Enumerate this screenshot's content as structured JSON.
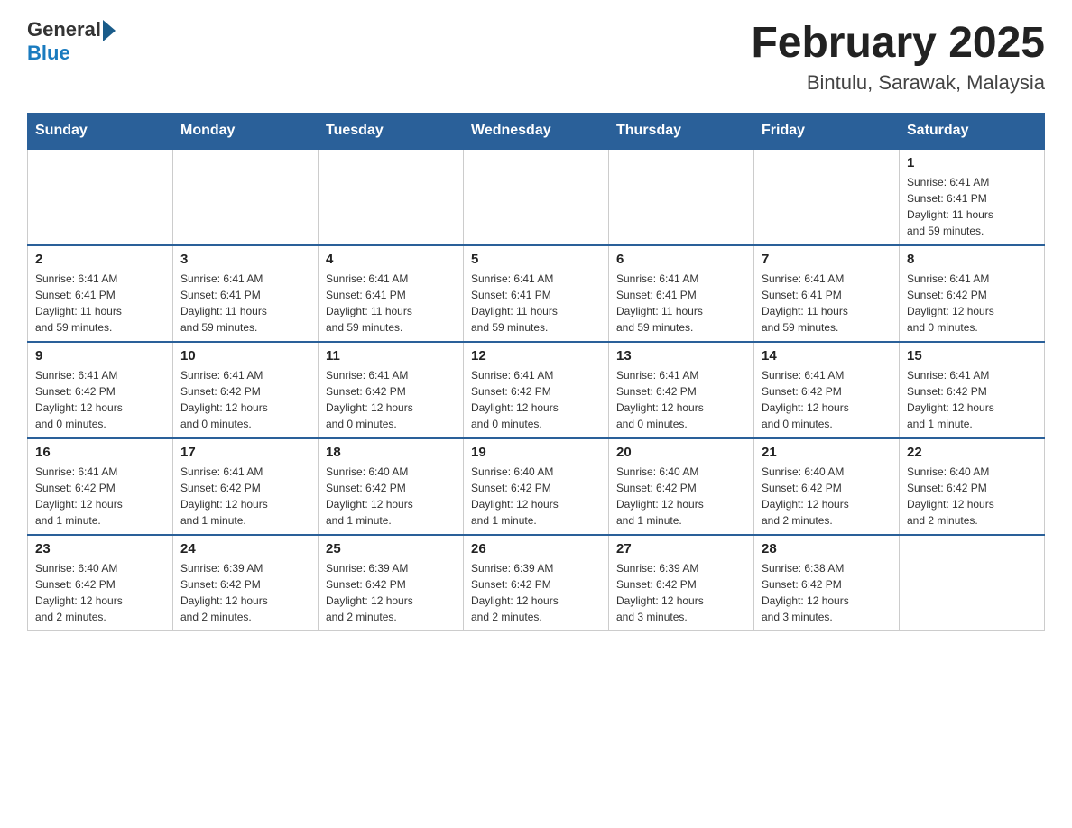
{
  "header": {
    "logo_general": "General",
    "logo_blue": "Blue",
    "title": "February 2025",
    "subtitle": "Bintulu, Sarawak, Malaysia"
  },
  "weekdays": [
    "Sunday",
    "Monday",
    "Tuesday",
    "Wednesday",
    "Thursday",
    "Friday",
    "Saturday"
  ],
  "weeks": [
    [
      {
        "day": "",
        "info": ""
      },
      {
        "day": "",
        "info": ""
      },
      {
        "day": "",
        "info": ""
      },
      {
        "day": "",
        "info": ""
      },
      {
        "day": "",
        "info": ""
      },
      {
        "day": "",
        "info": ""
      },
      {
        "day": "1",
        "info": "Sunrise: 6:41 AM\nSunset: 6:41 PM\nDaylight: 11 hours\nand 59 minutes."
      }
    ],
    [
      {
        "day": "2",
        "info": "Sunrise: 6:41 AM\nSunset: 6:41 PM\nDaylight: 11 hours\nand 59 minutes."
      },
      {
        "day": "3",
        "info": "Sunrise: 6:41 AM\nSunset: 6:41 PM\nDaylight: 11 hours\nand 59 minutes."
      },
      {
        "day": "4",
        "info": "Sunrise: 6:41 AM\nSunset: 6:41 PM\nDaylight: 11 hours\nand 59 minutes."
      },
      {
        "day": "5",
        "info": "Sunrise: 6:41 AM\nSunset: 6:41 PM\nDaylight: 11 hours\nand 59 minutes."
      },
      {
        "day": "6",
        "info": "Sunrise: 6:41 AM\nSunset: 6:41 PM\nDaylight: 11 hours\nand 59 minutes."
      },
      {
        "day": "7",
        "info": "Sunrise: 6:41 AM\nSunset: 6:41 PM\nDaylight: 11 hours\nand 59 minutes."
      },
      {
        "day": "8",
        "info": "Sunrise: 6:41 AM\nSunset: 6:42 PM\nDaylight: 12 hours\nand 0 minutes."
      }
    ],
    [
      {
        "day": "9",
        "info": "Sunrise: 6:41 AM\nSunset: 6:42 PM\nDaylight: 12 hours\nand 0 minutes."
      },
      {
        "day": "10",
        "info": "Sunrise: 6:41 AM\nSunset: 6:42 PM\nDaylight: 12 hours\nand 0 minutes."
      },
      {
        "day": "11",
        "info": "Sunrise: 6:41 AM\nSunset: 6:42 PM\nDaylight: 12 hours\nand 0 minutes."
      },
      {
        "day": "12",
        "info": "Sunrise: 6:41 AM\nSunset: 6:42 PM\nDaylight: 12 hours\nand 0 minutes."
      },
      {
        "day": "13",
        "info": "Sunrise: 6:41 AM\nSunset: 6:42 PM\nDaylight: 12 hours\nand 0 minutes."
      },
      {
        "day": "14",
        "info": "Sunrise: 6:41 AM\nSunset: 6:42 PM\nDaylight: 12 hours\nand 0 minutes."
      },
      {
        "day": "15",
        "info": "Sunrise: 6:41 AM\nSunset: 6:42 PM\nDaylight: 12 hours\nand 1 minute."
      }
    ],
    [
      {
        "day": "16",
        "info": "Sunrise: 6:41 AM\nSunset: 6:42 PM\nDaylight: 12 hours\nand 1 minute."
      },
      {
        "day": "17",
        "info": "Sunrise: 6:41 AM\nSunset: 6:42 PM\nDaylight: 12 hours\nand 1 minute."
      },
      {
        "day": "18",
        "info": "Sunrise: 6:40 AM\nSunset: 6:42 PM\nDaylight: 12 hours\nand 1 minute."
      },
      {
        "day": "19",
        "info": "Sunrise: 6:40 AM\nSunset: 6:42 PM\nDaylight: 12 hours\nand 1 minute."
      },
      {
        "day": "20",
        "info": "Sunrise: 6:40 AM\nSunset: 6:42 PM\nDaylight: 12 hours\nand 1 minute."
      },
      {
        "day": "21",
        "info": "Sunrise: 6:40 AM\nSunset: 6:42 PM\nDaylight: 12 hours\nand 2 minutes."
      },
      {
        "day": "22",
        "info": "Sunrise: 6:40 AM\nSunset: 6:42 PM\nDaylight: 12 hours\nand 2 minutes."
      }
    ],
    [
      {
        "day": "23",
        "info": "Sunrise: 6:40 AM\nSunset: 6:42 PM\nDaylight: 12 hours\nand 2 minutes."
      },
      {
        "day": "24",
        "info": "Sunrise: 6:39 AM\nSunset: 6:42 PM\nDaylight: 12 hours\nand 2 minutes."
      },
      {
        "day": "25",
        "info": "Sunrise: 6:39 AM\nSunset: 6:42 PM\nDaylight: 12 hours\nand 2 minutes."
      },
      {
        "day": "26",
        "info": "Sunrise: 6:39 AM\nSunset: 6:42 PM\nDaylight: 12 hours\nand 2 minutes."
      },
      {
        "day": "27",
        "info": "Sunrise: 6:39 AM\nSunset: 6:42 PM\nDaylight: 12 hours\nand 3 minutes."
      },
      {
        "day": "28",
        "info": "Sunrise: 6:38 AM\nSunset: 6:42 PM\nDaylight: 12 hours\nand 3 minutes."
      },
      {
        "day": "",
        "info": ""
      }
    ]
  ]
}
